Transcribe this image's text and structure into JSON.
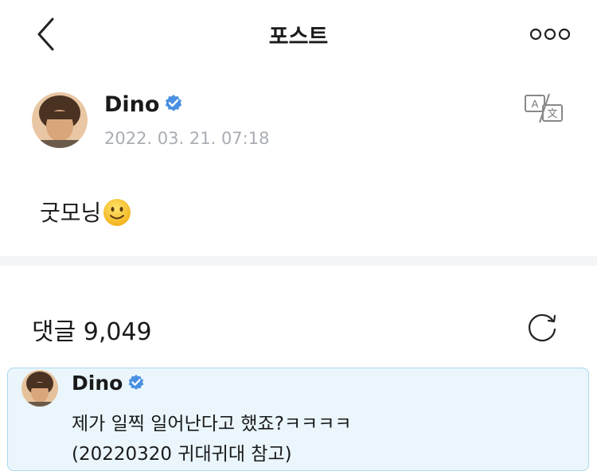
{
  "header": {
    "title": "포스트",
    "back_icon": "chevron-left-icon",
    "more_icon": "ellipsis-icon"
  },
  "post": {
    "author": "Dino",
    "date": "2022. 03. 21. 07:18",
    "text": "굿모닝",
    "emoji": "slightly-smiling-face",
    "translate_icon": "translate-icon",
    "verified_color": "#4a90e2"
  },
  "comments": {
    "label": "댓글 9,049",
    "refresh_icon": "refresh-icon",
    "items": [
      {
        "author": "Dino",
        "line1": "제가 일찍 일어난다고 했죠?ㅋㅋㅋㅋ",
        "line2": "(20220320 귀대귀대 참고)"
      }
    ]
  },
  "colors": {
    "highlight_bg": "#eaf6fc",
    "highlight_border": "#aad9ec",
    "muted": "#a9adb4"
  }
}
